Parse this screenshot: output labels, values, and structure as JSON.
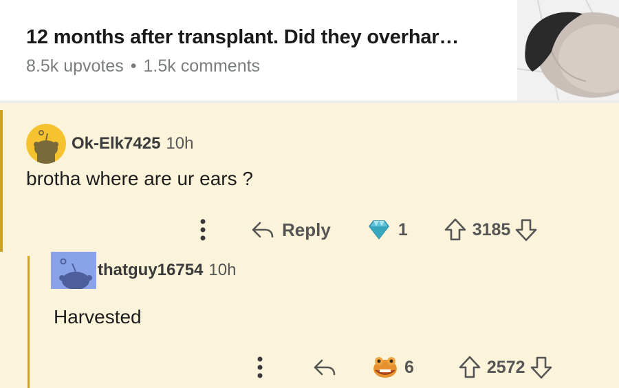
{
  "post": {
    "title": "12 months after transplant. Did they overhar…",
    "upvotes": "8.5k upvotes",
    "separator": "•",
    "comments": "1.5k comments"
  },
  "comments": [
    {
      "username": "Ok-Elk7425",
      "age": "10h",
      "text": "brotha where are ur ears ?",
      "reply_label": "Reply",
      "award_count": "1",
      "award_icon": "diamond-award-icon",
      "score": "3185"
    },
    {
      "username": "thatguy16754",
      "age": "10h",
      "text": "Harvested",
      "reply_label": "",
      "award_count": "6",
      "award_icon": "frog-award-icon",
      "score": "2572"
    }
  ],
  "colors": {
    "highlight_background": "#fbf3da",
    "thread_line": "#c9a227",
    "avatar_yellow": "#f5c330",
    "avatar_blue": "#8aa2e8"
  }
}
